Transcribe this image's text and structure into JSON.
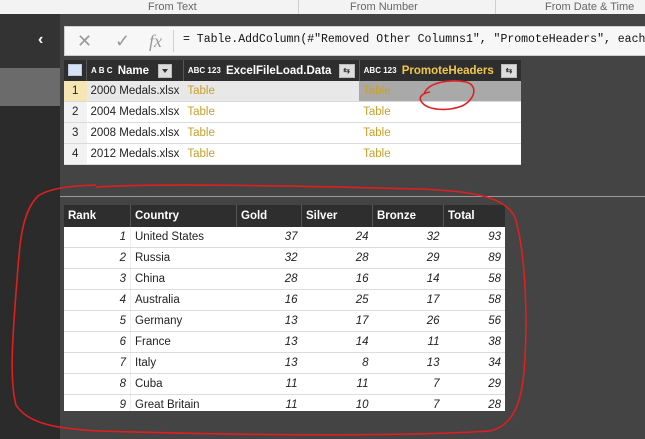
{
  "ribbon": {
    "items": [
      "From Text",
      "From Number",
      "From Date & Time"
    ]
  },
  "formula": {
    "text": "= Table.AddColumn(#\"Removed Other Columns1\", \"PromoteHeaders\", each Ta"
  },
  "toolbar": {
    "cancel": "✕",
    "commit": "✓",
    "fx": "fx"
  },
  "nav": {
    "collapse": "‹"
  },
  "top_table": {
    "type_label_text": "A B C",
    "type_label_any": "ABC 123",
    "columns": [
      "Name",
      "ExcelFileLoad.Data",
      "PromoteHeaders"
    ],
    "rows": [
      {
        "num": "1",
        "name": "2000 Medals.xlsx",
        "data": "Table",
        "promote": "Table"
      },
      {
        "num": "2",
        "name": "2004 Medals.xlsx",
        "data": "Table",
        "promote": "Table"
      },
      {
        "num": "3",
        "name": "2008 Medals.xlsx",
        "data": "Table",
        "promote": "Table"
      },
      {
        "num": "4",
        "name": "2012 Medals.xlsx",
        "data": "Table",
        "promote": "Table"
      }
    ],
    "header_color_promote": "#f2c94c"
  },
  "preview": {
    "columns": [
      "Rank",
      "Country",
      "Gold",
      "Silver",
      "Bronze",
      "Total"
    ],
    "rows": [
      [
        "1",
        "United States",
        "37",
        "24",
        "32",
        "93"
      ],
      [
        "2",
        "Russia",
        "32",
        "28",
        "29",
        "89"
      ],
      [
        "3",
        "China",
        "28",
        "16",
        "14",
        "58"
      ],
      [
        "4",
        "Australia",
        "16",
        "25",
        "17",
        "58"
      ],
      [
        "5",
        "Germany",
        "13",
        "17",
        "26",
        "56"
      ],
      [
        "6",
        "France",
        "13",
        "14",
        "11",
        "38"
      ],
      [
        "7",
        "Italy",
        "13",
        "8",
        "13",
        "34"
      ],
      [
        "8",
        "Cuba",
        "11",
        "11",
        "7",
        "29"
      ],
      [
        "9",
        "Great Britain",
        "11",
        "10",
        "7",
        "28"
      ]
    ]
  },
  "annotation_color": "#e02020"
}
